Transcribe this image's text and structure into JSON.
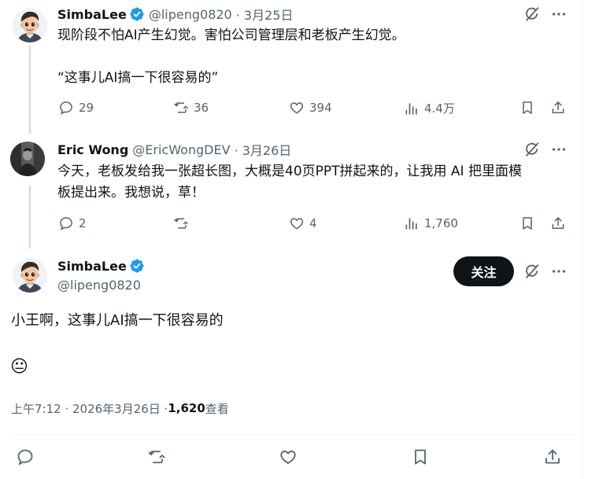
{
  "tweets": [
    {
      "name": "SimbaLee",
      "handle": "@lipeng0820",
      "date": "· 3月25日",
      "lines": [
        "现阶段不怕AI产生幻觉。害怕公司管理层和老板产生幻觉。",
        "",
        "“这事儿AI搞一下很容易的”"
      ],
      "replies": "29",
      "retweets": "36",
      "likes": "394",
      "views": "4.4万"
    },
    {
      "name": "Eric Wong",
      "handle": "@EricWongDEV",
      "date": "· 3月26日",
      "lines": [
        "今天，老板发给我一张超长图，大概是40页PPT拼起来的，让我用 AI 把里面模",
        "板提出来。我想说，草！"
      ],
      "replies": "2",
      "retweets": "",
      "likes": "4",
      "views": "1,760"
    }
  ],
  "main": {
    "name": "SimbaLee",
    "handle": "@lipeng0820",
    "follow_label": "关注",
    "text": "小王啊，这事儿AI搞一下很容易的",
    "emoji": "😐",
    "time": "上午7:12 · 2026年3月26日 · ",
    "views": "1,620",
    "views_label": " 查看"
  },
  "icons": {
    "reply": "reply-icon",
    "retweet": "retweet-icon",
    "like": "heart-icon",
    "views": "views-icon",
    "bookmark": "bookmark-icon",
    "share": "share-icon",
    "grok": "grok-icon",
    "more": "more-icon",
    "verified": "verified-badge-icon"
  },
  "colors": {
    "verified": "#1d9bf0",
    "text": "#0f1419",
    "muted": "#536471",
    "follow_bg": "#0f1419"
  }
}
